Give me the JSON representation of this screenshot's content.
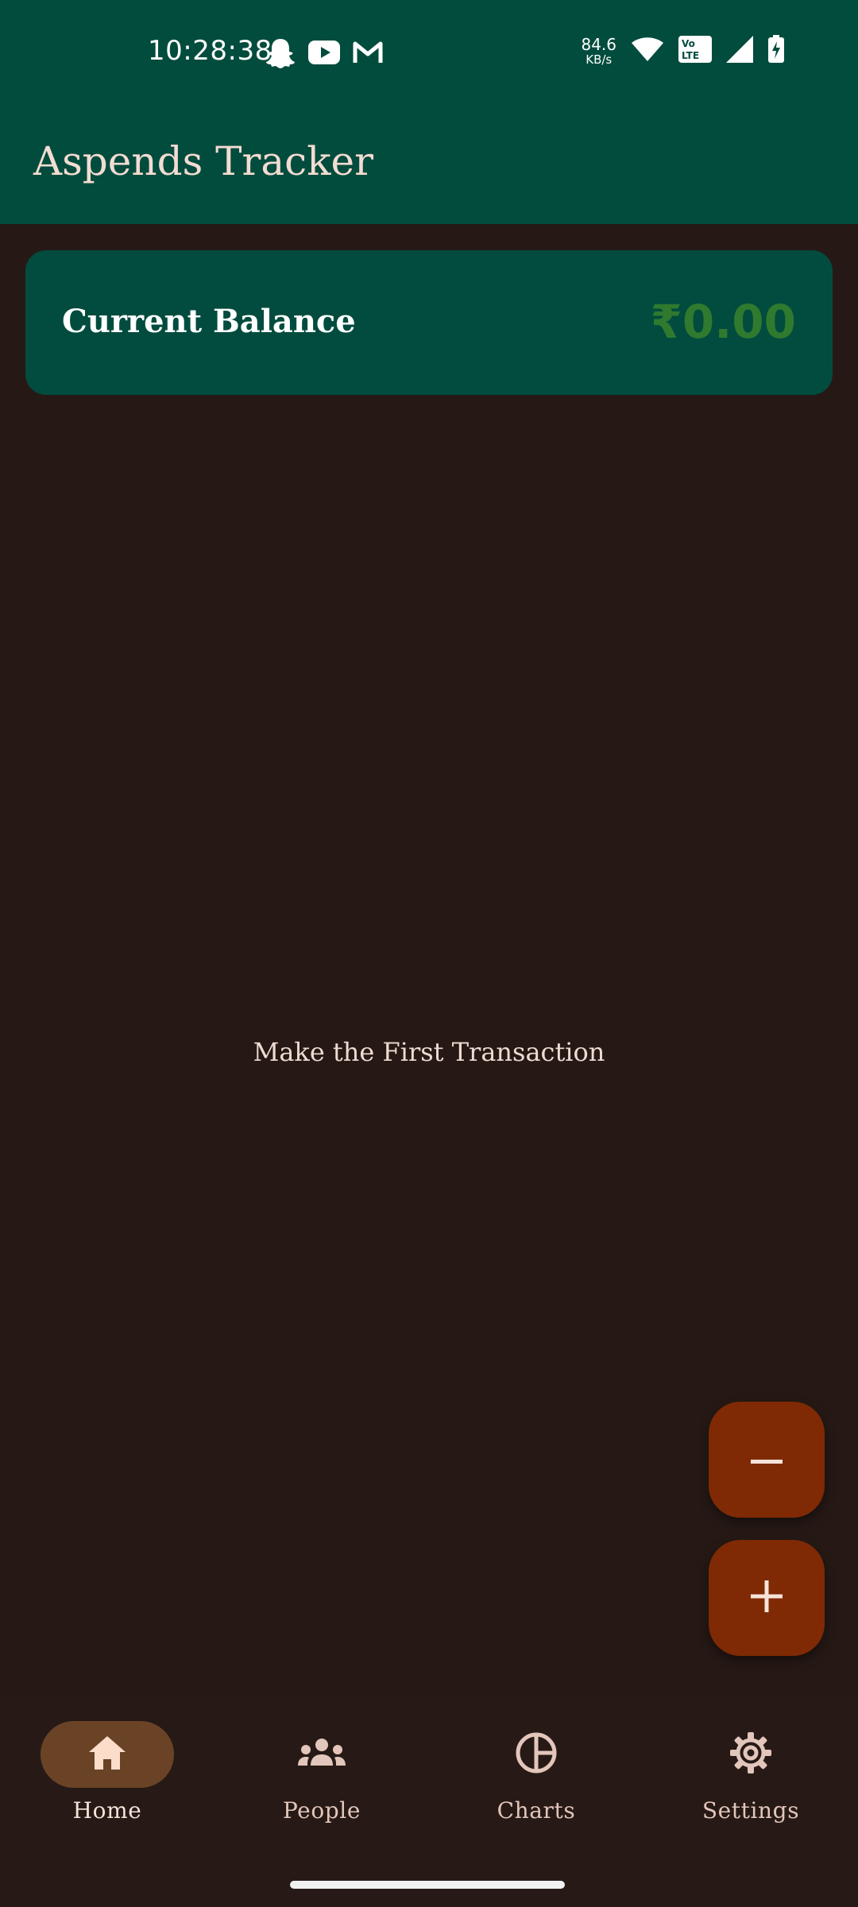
{
  "status_bar": {
    "time": "10:28:38",
    "net_speed_value": "84.6",
    "net_speed_unit": "KB/s",
    "volte": "Vo LTE",
    "left_icons": [
      "snapchat-icon",
      "youtube-icon",
      "gmail-icon"
    ],
    "right_icons": [
      "wifi-icon",
      "volte-icon",
      "signal-icon",
      "battery-charging-icon"
    ]
  },
  "app_bar": {
    "title": "Aspends Tracker"
  },
  "balance": {
    "label": "Current Balance",
    "value": "₹0.00",
    "value_color": "#2f7a2e"
  },
  "main": {
    "empty_message": "Make the First Transaction"
  },
  "fabs": {
    "subtract_icon": "minus-icon",
    "add_icon": "plus-icon"
  },
  "nav": {
    "items": [
      {
        "label": "Home",
        "icon": "home-icon",
        "active": true
      },
      {
        "label": "People",
        "icon": "people-icon",
        "active": false
      },
      {
        "label": "Charts",
        "icon": "pie-chart-icon",
        "active": false
      },
      {
        "label": "Settings",
        "icon": "gear-icon",
        "active": false
      }
    ]
  },
  "colors": {
    "app_bar": "#024c3d",
    "background": "#261915",
    "fab": "#7f2a04",
    "nav_active_pill": "#6a4326"
  }
}
